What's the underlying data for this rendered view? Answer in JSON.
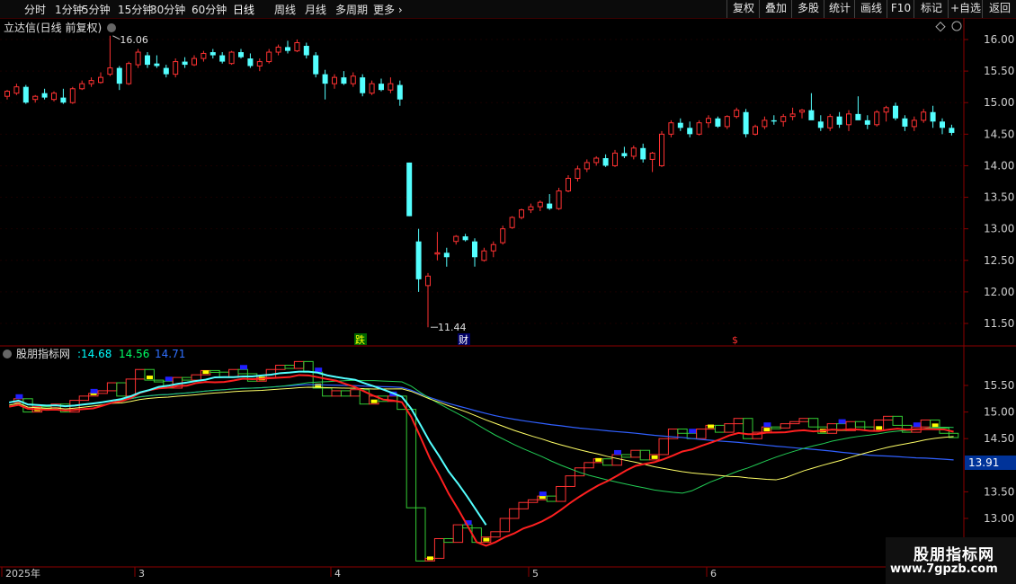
{
  "toolbar": {
    "left_items": [
      "分时",
      "1分钟",
      "5分钟",
      "15分钟",
      "30分钟",
      "60分钟",
      "日线",
      "周线",
      "月线",
      "多周期",
      "更多"
    ],
    "active": "日线",
    "right_items": [
      "复权",
      "叠加",
      "多股",
      "统计",
      "画线",
      "F10",
      "标记",
      "+自选",
      "返回"
    ]
  },
  "main_panel": {
    "title": "立达信(日线 前复权)",
    "y_ticks": [
      "16.00",
      "15.50",
      "15.00",
      "14.50",
      "14.00",
      "13.50",
      "13.00",
      "12.50",
      "12.00",
      "11.50"
    ],
    "high_label": "16.06",
    "low_label": "11.44",
    "markers": [
      {
        "text": "跌",
        "color": "#ffff00",
        "bg": "#006600",
        "day": 15
      },
      {
        "text": "财",
        "color": "#ffffff",
        "bg": "#000066",
        "day": 22
      },
      {
        "text": "$",
        "color": "#ff3030",
        "bg": "",
        "day": 49
      }
    ]
  },
  "indicator_panel": {
    "name": "股朋指标网",
    "values": [
      "14.68",
      "14.56",
      "14.71"
    ],
    "value_colors": [
      "#00ffff",
      "#00ff66",
      "#3070ff"
    ],
    "y_ticks": [
      "15.50",
      "15.00",
      "14.50",
      "13.50",
      "13.00"
    ],
    "price_tag": "13.91"
  },
  "x_axis": {
    "labels": [
      {
        "text": "2025年",
        "day": 0
      },
      {
        "text": "3",
        "day": 8
      },
      {
        "text": "4",
        "day": 22
      },
      {
        "text": "5",
        "day": 37
      },
      {
        "text": "6",
        "day": 50
      }
    ]
  },
  "watermark": {
    "title": "股朋指标网",
    "url": "www.7gpzb.com"
  },
  "colors": {
    "up": "#ff3232",
    "down": "#54ffff",
    "axis": "#8b0000",
    "tick": "#d0d0d0"
  },
  "chart_data": {
    "type": "candlestick",
    "ohlc": [
      [
        15.1,
        15.2,
        15.05,
        15.18
      ],
      [
        15.15,
        15.3,
        15.12,
        15.25
      ],
      [
        15.25,
        15.28,
        14.98,
        15.0
      ],
      [
        15.05,
        15.12,
        15.0,
        15.1
      ],
      [
        15.15,
        15.22,
        15.05,
        15.08
      ],
      [
        15.05,
        15.18,
        15.02,
        15.15
      ],
      [
        15.08,
        15.22,
        14.98,
        15.0
      ],
      [
        15.0,
        15.25,
        14.98,
        15.22
      ],
      [
        15.22,
        15.35,
        15.2,
        15.3
      ],
      [
        15.3,
        15.4,
        15.25,
        15.35
      ],
      [
        15.32,
        15.48,
        15.3,
        15.4
      ],
      [
        15.45,
        16.06,
        15.42,
        15.55
      ],
      [
        15.55,
        15.58,
        15.2,
        15.3
      ],
      [
        15.3,
        15.65,
        15.28,
        15.62
      ],
      [
        15.6,
        15.85,
        15.55,
        15.8
      ],
      [
        15.75,
        15.8,
        15.55,
        15.6
      ],
      [
        15.62,
        15.75,
        15.55,
        15.58
      ],
      [
        15.55,
        15.6,
        15.4,
        15.45
      ],
      [
        15.45,
        15.7,
        15.4,
        15.65
      ],
      [
        15.65,
        15.72,
        15.55,
        15.6
      ],
      [
        15.6,
        15.75,
        15.58,
        15.7
      ],
      [
        15.7,
        15.82,
        15.65,
        15.78
      ],
      [
        15.8,
        15.85,
        15.7,
        15.75
      ],
      [
        15.75,
        15.8,
        15.62,
        15.65
      ],
      [
        15.62,
        15.82,
        15.6,
        15.8
      ],
      [
        15.8,
        15.85,
        15.7,
        15.72
      ],
      [
        15.7,
        15.78,
        15.55,
        15.58
      ],
      [
        15.58,
        15.7,
        15.5,
        15.65
      ],
      [
        15.65,
        15.85,
        15.62,
        15.8
      ],
      [
        15.8,
        15.92,
        15.75,
        15.88
      ],
      [
        15.88,
        15.98,
        15.78,
        15.82
      ],
      [
        15.82,
        16.0,
        15.8,
        15.95
      ],
      [
        15.9,
        15.95,
        15.7,
        15.75
      ],
      [
        15.75,
        15.8,
        15.4,
        15.45
      ],
      [
        15.45,
        15.52,
        15.05,
        15.3
      ],
      [
        15.3,
        15.45,
        15.22,
        15.4
      ],
      [
        15.4,
        15.5,
        15.28,
        15.3
      ],
      [
        15.3,
        15.48,
        15.25,
        15.42
      ],
      [
        15.4,
        15.45,
        15.1,
        15.15
      ],
      [
        15.15,
        15.35,
        15.12,
        15.3
      ],
      [
        15.3,
        15.38,
        15.18,
        15.2
      ],
      [
        15.2,
        15.4,
        15.15,
        15.3
      ],
      [
        15.28,
        15.35,
        14.95,
        15.05
      ],
      [
        14.05,
        14.05,
        13.2,
        13.2
      ],
      [
        12.8,
        13.0,
        12.0,
        12.2
      ],
      [
        12.1,
        12.3,
        11.44,
        12.25
      ],
      [
        12.6,
        12.95,
        12.5,
        12.62
      ],
      [
        12.62,
        12.7,
        12.4,
        12.55
      ],
      [
        12.8,
        12.9,
        12.75,
        12.88
      ],
      [
        12.88,
        12.92,
        12.8,
        12.82
      ],
      [
        12.8,
        12.85,
        12.4,
        12.55
      ],
      [
        12.5,
        12.7,
        12.48,
        12.65
      ],
      [
        12.65,
        12.8,
        12.55,
        12.75
      ],
      [
        12.78,
        13.05,
        12.75,
        13.0
      ],
      [
        13.02,
        13.2,
        13.0,
        13.18
      ],
      [
        13.18,
        13.32,
        13.15,
        13.3
      ],
      [
        13.3,
        13.4,
        13.25,
        13.35
      ],
      [
        13.35,
        13.45,
        13.28,
        13.42
      ],
      [
        13.4,
        13.55,
        13.3,
        13.32
      ],
      [
        13.32,
        13.65,
        13.3,
        13.6
      ],
      [
        13.6,
        13.85,
        13.58,
        13.8
      ],
      [
        13.8,
        14.0,
        13.75,
        13.95
      ],
      [
        13.95,
        14.1,
        13.9,
        14.05
      ],
      [
        14.05,
        14.15,
        14.0,
        14.12
      ],
      [
        14.12,
        14.18,
        13.98,
        14.0
      ],
      [
        14.0,
        14.25,
        13.98,
        14.2
      ],
      [
        14.2,
        14.3,
        14.12,
        14.15
      ],
      [
        14.15,
        14.32,
        14.1,
        14.28
      ],
      [
        14.28,
        14.35,
        14.05,
        14.1
      ],
      [
        14.1,
        14.22,
        13.9,
        14.2
      ],
      [
        14.0,
        14.55,
        13.98,
        14.5
      ],
      [
        14.5,
        14.72,
        14.45,
        14.68
      ],
      [
        14.68,
        14.75,
        14.55,
        14.6
      ],
      [
        14.6,
        14.7,
        14.45,
        14.5
      ],
      [
        14.5,
        14.72,
        14.48,
        14.68
      ],
      [
        14.68,
        14.8,
        14.6,
        14.75
      ],
      [
        14.75,
        14.78,
        14.6,
        14.62
      ],
      [
        14.62,
        14.8,
        14.58,
        14.78
      ],
      [
        14.78,
        14.92,
        14.75,
        14.88
      ],
      [
        14.85,
        14.9,
        14.45,
        14.5
      ],
      [
        14.5,
        14.65,
        14.48,
        14.62
      ],
      [
        14.62,
        14.78,
        14.58,
        14.72
      ],
      [
        14.72,
        14.8,
        14.65,
        14.7
      ],
      [
        14.7,
        14.82,
        14.62,
        14.78
      ],
      [
        14.78,
        14.92,
        14.72,
        14.82
      ],
      [
        14.85,
        14.9,
        14.75,
        14.88
      ],
      [
        14.88,
        15.15,
        14.8,
        14.72
      ],
      [
        14.7,
        14.8,
        14.55,
        14.6
      ],
      [
        14.6,
        14.82,
        14.55,
        14.78
      ],
      [
        14.78,
        14.85,
        14.6,
        14.65
      ],
      [
        14.65,
        14.88,
        14.55,
        14.82
      ],
      [
        14.82,
        15.1,
        14.78,
        14.72
      ],
      [
        14.72,
        14.8,
        14.58,
        14.65
      ],
      [
        14.65,
        14.88,
        14.62,
        14.85
      ],
      [
        14.85,
        14.95,
        14.7,
        14.92
      ],
      [
        14.95,
        15.0,
        14.72,
        14.75
      ],
      [
        14.75,
        14.8,
        14.55,
        14.62
      ],
      [
        14.62,
        14.78,
        14.55,
        14.72
      ],
      [
        14.72,
        14.9,
        14.68,
        14.85
      ],
      [
        14.85,
        14.95,
        14.6,
        14.7
      ],
      [
        14.7,
        14.75,
        14.5,
        14.6
      ],
      [
        14.6,
        14.65,
        14.48,
        14.52
      ]
    ],
    "ylim": [
      11.3,
      16.2
    ]
  }
}
